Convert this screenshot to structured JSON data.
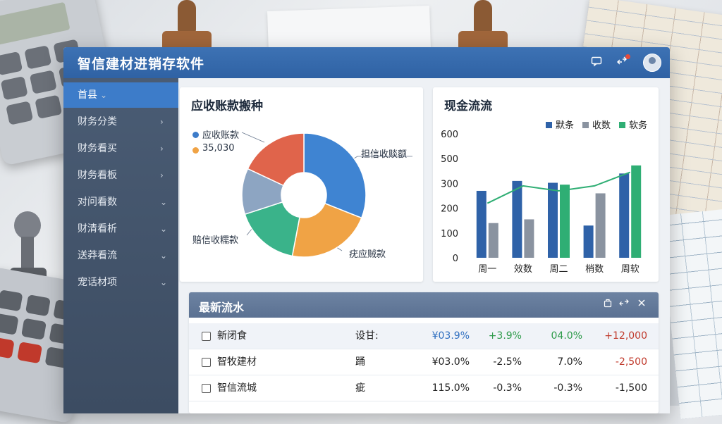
{
  "app": {
    "title": "智信建材进销存软件"
  },
  "titlebar": {
    "icons": [
      "message-icon",
      "share-icon",
      "avatar"
    ]
  },
  "sidebar": {
    "items": [
      {
        "label": "首县",
        "chevron": "⌄",
        "active": true
      },
      {
        "label": "财务分类",
        "chevron": "›"
      },
      {
        "label": "财务看买",
        "chevron": "›"
      },
      {
        "label": "财务看板",
        "chevron": "›"
      },
      {
        "label": "对问看数",
        "chevron": "⌄"
      },
      {
        "label": "财清看析",
        "chevron": "⌄"
      },
      {
        "label": "送莽看流",
        "chevron": "⌄"
      },
      {
        "label": "宠话材项",
        "chevron": "⌄"
      }
    ]
  },
  "pie": {
    "title": "应收账款搬种",
    "legend": [
      {
        "label": "应收账款",
        "color": "#3d7cc9"
      },
      {
        "label": "35,030",
        "color": "#f0a345"
      }
    ],
    "labels": {
      "right": "担信收赕额",
      "left": "赔信收糯款",
      "bottom": "疣应贼款"
    },
    "slices": [
      {
        "value": 31,
        "color": "#3f84d2"
      },
      {
        "value": 22,
        "color": "#f0a345"
      },
      {
        "value": 17,
        "color": "#3ab38a"
      },
      {
        "value": 12,
        "color": "#8da5c2"
      },
      {
        "value": 18,
        "color": "#e0644b"
      }
    ]
  },
  "chart_data": {
    "type": "bar",
    "title": "现金流流",
    "categories": [
      "周一",
      "效数",
      "周二",
      "梢数",
      "周软"
    ],
    "series": [
      {
        "name": "默条",
        "color": "#2f62a8",
        "values": [
          270,
          320,
          305,
          130,
          380
        ]
      },
      {
        "name": "收数",
        "color": "#8a93a0",
        "values": [
          140,
          155,
          0,
          260,
          0
        ]
      },
      {
        "name": "软务",
        "color": "#2fae74",
        "values": [
          0,
          0,
          295,
          0,
          445
        ]
      }
    ],
    "line": {
      "color": "#2fae74",
      "values": [
        220,
        290,
        270,
        290,
        390
      ]
    },
    "yticks": [
      0,
      100,
      200,
      300,
      500,
      600
    ],
    "ylim": [
      0,
      500
    ],
    "legend_position": "top-right"
  },
  "flow": {
    "title": "最新流水",
    "rows": [
      {
        "name": "新闭食",
        "type": "设甘:",
        "a": "¥03.9%",
        "b": "+3.9%",
        "c": "04.0%",
        "d": "+12,000",
        "colors": [
          "#2f6fc0",
          "#2e9b4a",
          "#2e9b4a",
          "#c0392b"
        ]
      },
      {
        "name": "智牧建材",
        "type": "踊",
        "a": "¥03.0%",
        "b": "-2.5%",
        "c": "7.0%",
        "d": "-2,500",
        "colors": [
          "#222",
          "#222",
          "#222",
          "#c0392b"
        ]
      },
      {
        "name": "智信流城",
        "type": "疵",
        "a": "115.0%",
        "b": "-0.3%",
        "c": "-0.3%",
        "d": "-1,500",
        "colors": [
          "#222",
          "#222",
          "#222",
          "#222"
        ]
      }
    ]
  }
}
